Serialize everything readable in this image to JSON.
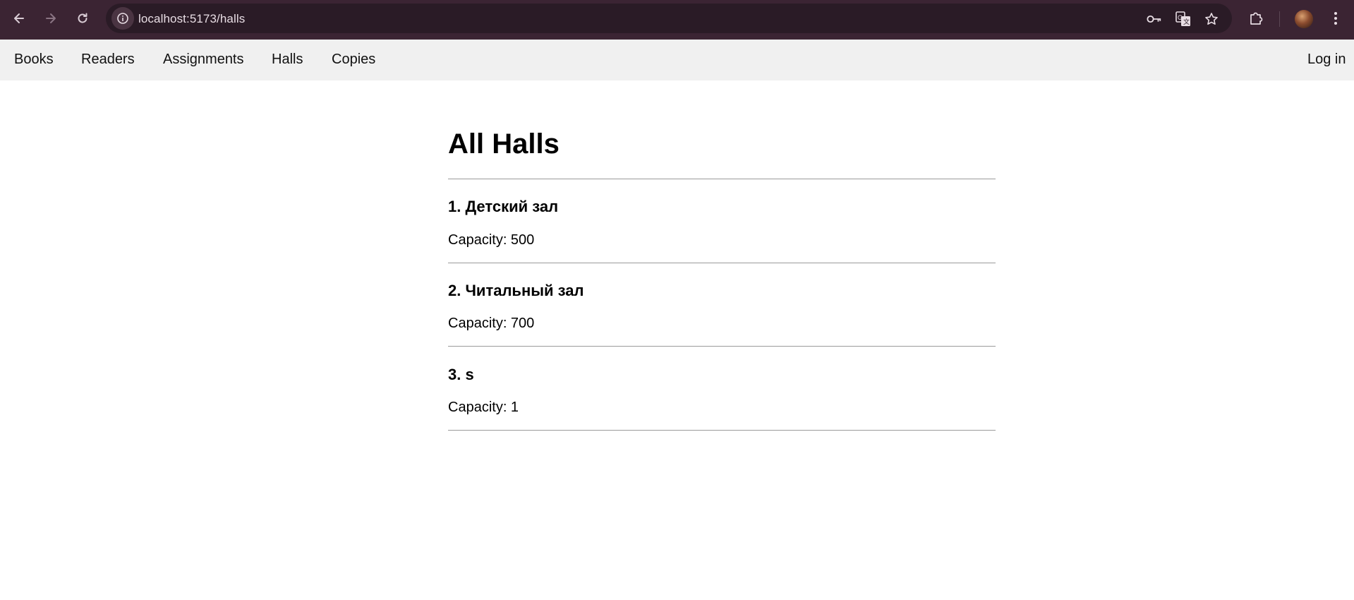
{
  "browser": {
    "url": "localhost:5173/halls",
    "icons": [
      "back-arrow-icon",
      "forward-arrow-icon",
      "reload-icon",
      "site-info-icon",
      "password-key-icon",
      "translate-icon",
      "bookmark-star-icon",
      "extensions-puzzle-icon",
      "profile-avatar",
      "kebab-menu-icon"
    ]
  },
  "nav": {
    "links": [
      "Books",
      "Readers",
      "Assignments",
      "Halls",
      "Copies"
    ],
    "login": "Log in"
  },
  "page": {
    "title": "All Halls",
    "halls": [
      {
        "name": "1. Детский зал",
        "capacity": "Capacity: 500"
      },
      {
        "name": "2. Читальный зал",
        "capacity": "Capacity: 700"
      },
      {
        "name": "3. s",
        "capacity": "Capacity: 1"
      }
    ]
  }
}
